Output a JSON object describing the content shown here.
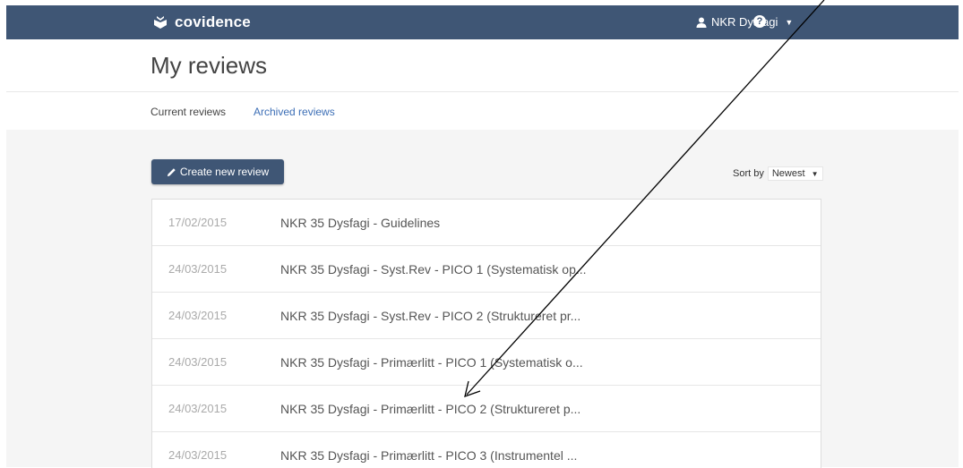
{
  "navbar": {
    "brand": "covidence",
    "user_name": "NKR Dysfagi",
    "help_glyph": "?",
    "caret_glyph": "▼",
    "background": "#3f5675"
  },
  "page": {
    "title": "My reviews"
  },
  "tabs": [
    {
      "label": "Current reviews",
      "active": true
    },
    {
      "label": "Archived reviews",
      "active": false
    }
  ],
  "toolbar": {
    "create_label": "Create new review",
    "sort_label": "Sort by",
    "sort_value": "Newest",
    "sort_caret": "▼"
  },
  "reviews": [
    {
      "date": "17/02/2015",
      "title": "NKR 35 Dysfagi - Guidelines"
    },
    {
      "date": "24/03/2015",
      "title": "NKR 35 Dysfagi - Syst.Rev - PICO 1 (Systematisk op..."
    },
    {
      "date": "24/03/2015",
      "title": "NKR 35 Dysfagi - Syst.Rev - PICO 2 (Struktureret pr..."
    },
    {
      "date": "24/03/2015",
      "title": "NKR 35 Dysfagi - Primærlitt - PICO 1 (Systematisk o..."
    },
    {
      "date": "24/03/2015",
      "title": "NKR 35 Dysfagi - Primærlitt - PICO 2 (Struktureret p..."
    },
    {
      "date": "24/03/2015",
      "title": "NKR 35 Dysfagi - Primærlitt - PICO 3 (Instrumentel ..."
    }
  ],
  "colors": {
    "accent_tab": "#f29b1d",
    "link": "#3d6fb6",
    "annotation": "#000000"
  },
  "icons": {
    "brand": "covidence-logo-icon",
    "user": "user-icon",
    "help": "help-icon",
    "pencil": "pencil-icon"
  }
}
